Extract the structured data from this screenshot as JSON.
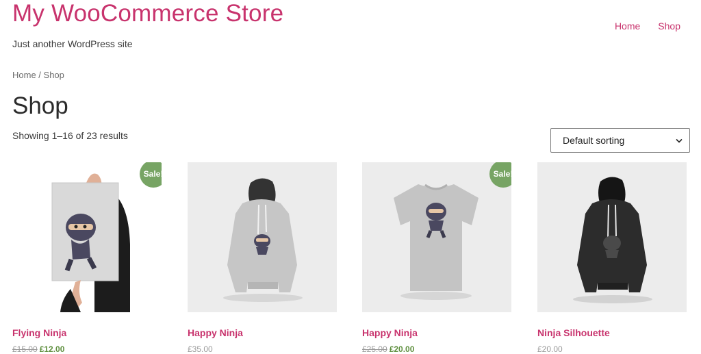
{
  "site": {
    "title": "My WooCommerce Store",
    "tagline": "Just another WordPress site"
  },
  "nav": {
    "items": [
      "Home",
      "Shop"
    ]
  },
  "breadcrumb": {
    "home": "Home",
    "separator": " / ",
    "current": "Shop"
  },
  "page": {
    "title": "Shop",
    "result_count": "Showing 1–16 of 23 results"
  },
  "sorting": {
    "selected": "Default sorting"
  },
  "products": [
    {
      "title": "Flying Ninja",
      "regular_price": "£15.00",
      "sale_price": "£12.00",
      "sale_badge": "Sale!",
      "image": "poster-ninja"
    },
    {
      "title": "Happy Ninja",
      "price": "£35.00",
      "image": "grey-hoodie-ninja"
    },
    {
      "title": "Happy Ninja",
      "regular_price": "£25.00",
      "sale_price": "£20.00",
      "sale_badge": "Sale!",
      "image": "grey-tshirt-ninja"
    },
    {
      "title": "Ninja Silhouette",
      "price": "£20.00",
      "image": "black-hoodie-ninja"
    }
  ],
  "colors": {
    "accent": "#c8336d",
    "sale_badge": "#77a464",
    "thumb_bg": "#ececec"
  }
}
